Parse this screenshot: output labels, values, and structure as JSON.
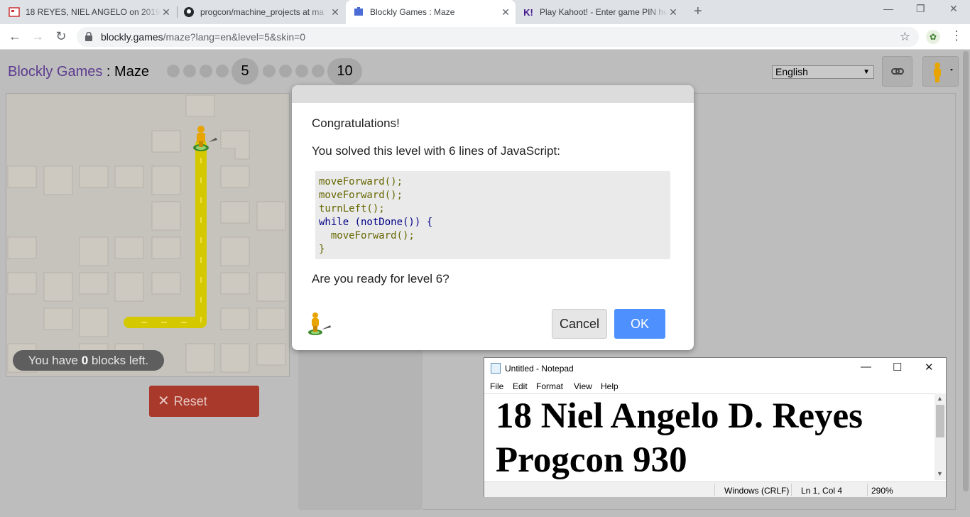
{
  "browser": {
    "tabs": [
      {
        "title": "18 REYES, NIEL ANGELO on 2019",
        "icon": "google-classroom-icon"
      },
      {
        "title": "progcon/machine_projects at ma",
        "icon": "github-icon"
      },
      {
        "title": "Blockly Games : Maze",
        "icon": "blockly-icon"
      },
      {
        "title": "Play Kahoot! - Enter game PIN he",
        "icon": "kahoot-icon"
      }
    ],
    "active_tab": 2,
    "new_tab": "+",
    "url_host": "blockly.games",
    "url_path": "/maze?lang=en&level=5&skin=0"
  },
  "header": {
    "app_name": "Blockly Games",
    "separator": " : ",
    "game": "Maze",
    "levels": {
      "current": "5",
      "last": "10"
    },
    "language": "English"
  },
  "maze": {
    "blocks_left_prefix": "You have ",
    "blocks_left_count": "0",
    "blocks_left_suffix": " blocks left.",
    "reset_label": "Reset",
    "path_color": "#d4c900"
  },
  "dialog": {
    "congrats": "Congratulations!",
    "solved": "You solved this level with 6 lines of JavaScript:",
    "code_lines": [
      "moveForward();",
      "moveForward();",
      "turnLeft();",
      "while (notDone()) {",
      "  moveForward();",
      "}"
    ],
    "question": "Are you ready for level 6?",
    "cancel_label": "Cancel",
    "ok_label": "OK"
  },
  "notepad": {
    "title": "Untitled - Notepad",
    "menu": [
      "File",
      "Edit",
      "Format",
      "View",
      "Help"
    ],
    "text_lines": [
      "18 Niel Angelo D. Reyes",
      "Progcon 930"
    ],
    "status": {
      "eol": "Windows (CRLF)",
      "position": "Ln 1, Col 4",
      "zoom": "290%"
    }
  },
  "colors": {
    "accent": "#4d90fe",
    "reset": "#a8392b",
    "brand": "#5c3b8f"
  }
}
